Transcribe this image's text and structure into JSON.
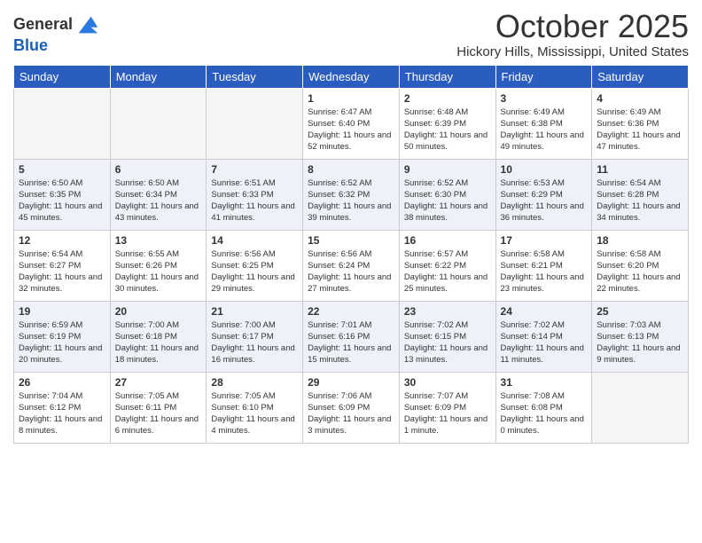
{
  "logo": {
    "line1": "General",
    "line2": "Blue"
  },
  "header": {
    "month": "October 2025",
    "location": "Hickory Hills, Mississippi, United States"
  },
  "weekdays": [
    "Sunday",
    "Monday",
    "Tuesday",
    "Wednesday",
    "Thursday",
    "Friday",
    "Saturday"
  ],
  "weeks": [
    [
      {
        "day": "",
        "empty": true
      },
      {
        "day": "",
        "empty": true
      },
      {
        "day": "",
        "empty": true
      },
      {
        "day": "1",
        "sunrise": "Sunrise: 6:47 AM",
        "sunset": "Sunset: 6:40 PM",
        "daylight": "Daylight: 11 hours and 52 minutes."
      },
      {
        "day": "2",
        "sunrise": "Sunrise: 6:48 AM",
        "sunset": "Sunset: 6:39 PM",
        "daylight": "Daylight: 11 hours and 50 minutes."
      },
      {
        "day": "3",
        "sunrise": "Sunrise: 6:49 AM",
        "sunset": "Sunset: 6:38 PM",
        "daylight": "Daylight: 11 hours and 49 minutes."
      },
      {
        "day": "4",
        "sunrise": "Sunrise: 6:49 AM",
        "sunset": "Sunset: 6:36 PM",
        "daylight": "Daylight: 11 hours and 47 minutes."
      }
    ],
    [
      {
        "day": "5",
        "sunrise": "Sunrise: 6:50 AM",
        "sunset": "Sunset: 6:35 PM",
        "daylight": "Daylight: 11 hours and 45 minutes."
      },
      {
        "day": "6",
        "sunrise": "Sunrise: 6:50 AM",
        "sunset": "Sunset: 6:34 PM",
        "daylight": "Daylight: 11 hours and 43 minutes."
      },
      {
        "day": "7",
        "sunrise": "Sunrise: 6:51 AM",
        "sunset": "Sunset: 6:33 PM",
        "daylight": "Daylight: 11 hours and 41 minutes."
      },
      {
        "day": "8",
        "sunrise": "Sunrise: 6:52 AM",
        "sunset": "Sunset: 6:32 PM",
        "daylight": "Daylight: 11 hours and 39 minutes."
      },
      {
        "day": "9",
        "sunrise": "Sunrise: 6:52 AM",
        "sunset": "Sunset: 6:30 PM",
        "daylight": "Daylight: 11 hours and 38 minutes."
      },
      {
        "day": "10",
        "sunrise": "Sunrise: 6:53 AM",
        "sunset": "Sunset: 6:29 PM",
        "daylight": "Daylight: 11 hours and 36 minutes."
      },
      {
        "day": "11",
        "sunrise": "Sunrise: 6:54 AM",
        "sunset": "Sunset: 6:28 PM",
        "daylight": "Daylight: 11 hours and 34 minutes."
      }
    ],
    [
      {
        "day": "12",
        "sunrise": "Sunrise: 6:54 AM",
        "sunset": "Sunset: 6:27 PM",
        "daylight": "Daylight: 11 hours and 32 minutes."
      },
      {
        "day": "13",
        "sunrise": "Sunrise: 6:55 AM",
        "sunset": "Sunset: 6:26 PM",
        "daylight": "Daylight: 11 hours and 30 minutes."
      },
      {
        "day": "14",
        "sunrise": "Sunrise: 6:56 AM",
        "sunset": "Sunset: 6:25 PM",
        "daylight": "Daylight: 11 hours and 29 minutes."
      },
      {
        "day": "15",
        "sunrise": "Sunrise: 6:56 AM",
        "sunset": "Sunset: 6:24 PM",
        "daylight": "Daylight: 11 hours and 27 minutes."
      },
      {
        "day": "16",
        "sunrise": "Sunrise: 6:57 AM",
        "sunset": "Sunset: 6:22 PM",
        "daylight": "Daylight: 11 hours and 25 minutes."
      },
      {
        "day": "17",
        "sunrise": "Sunrise: 6:58 AM",
        "sunset": "Sunset: 6:21 PM",
        "daylight": "Daylight: 11 hours and 23 minutes."
      },
      {
        "day": "18",
        "sunrise": "Sunrise: 6:58 AM",
        "sunset": "Sunset: 6:20 PM",
        "daylight": "Daylight: 11 hours and 22 minutes."
      }
    ],
    [
      {
        "day": "19",
        "sunrise": "Sunrise: 6:59 AM",
        "sunset": "Sunset: 6:19 PM",
        "daylight": "Daylight: 11 hours and 20 minutes."
      },
      {
        "day": "20",
        "sunrise": "Sunrise: 7:00 AM",
        "sunset": "Sunset: 6:18 PM",
        "daylight": "Daylight: 11 hours and 18 minutes."
      },
      {
        "day": "21",
        "sunrise": "Sunrise: 7:00 AM",
        "sunset": "Sunset: 6:17 PM",
        "daylight": "Daylight: 11 hours and 16 minutes."
      },
      {
        "day": "22",
        "sunrise": "Sunrise: 7:01 AM",
        "sunset": "Sunset: 6:16 PM",
        "daylight": "Daylight: 11 hours and 15 minutes."
      },
      {
        "day": "23",
        "sunrise": "Sunrise: 7:02 AM",
        "sunset": "Sunset: 6:15 PM",
        "daylight": "Daylight: 11 hours and 13 minutes."
      },
      {
        "day": "24",
        "sunrise": "Sunrise: 7:02 AM",
        "sunset": "Sunset: 6:14 PM",
        "daylight": "Daylight: 11 hours and 11 minutes."
      },
      {
        "day": "25",
        "sunrise": "Sunrise: 7:03 AM",
        "sunset": "Sunset: 6:13 PM",
        "daylight": "Daylight: 11 hours and 9 minutes."
      }
    ],
    [
      {
        "day": "26",
        "sunrise": "Sunrise: 7:04 AM",
        "sunset": "Sunset: 6:12 PM",
        "daylight": "Daylight: 11 hours and 8 minutes."
      },
      {
        "day": "27",
        "sunrise": "Sunrise: 7:05 AM",
        "sunset": "Sunset: 6:11 PM",
        "daylight": "Daylight: 11 hours and 6 minutes."
      },
      {
        "day": "28",
        "sunrise": "Sunrise: 7:05 AM",
        "sunset": "Sunset: 6:10 PM",
        "daylight": "Daylight: 11 hours and 4 minutes."
      },
      {
        "day": "29",
        "sunrise": "Sunrise: 7:06 AM",
        "sunset": "Sunset: 6:09 PM",
        "daylight": "Daylight: 11 hours and 3 minutes."
      },
      {
        "day": "30",
        "sunrise": "Sunrise: 7:07 AM",
        "sunset": "Sunset: 6:09 PM",
        "daylight": "Daylight: 11 hours and 1 minute."
      },
      {
        "day": "31",
        "sunrise": "Sunrise: 7:08 AM",
        "sunset": "Sunset: 6:08 PM",
        "daylight": "Daylight: 11 hours and 0 minutes."
      },
      {
        "day": "",
        "empty": true
      }
    ]
  ]
}
